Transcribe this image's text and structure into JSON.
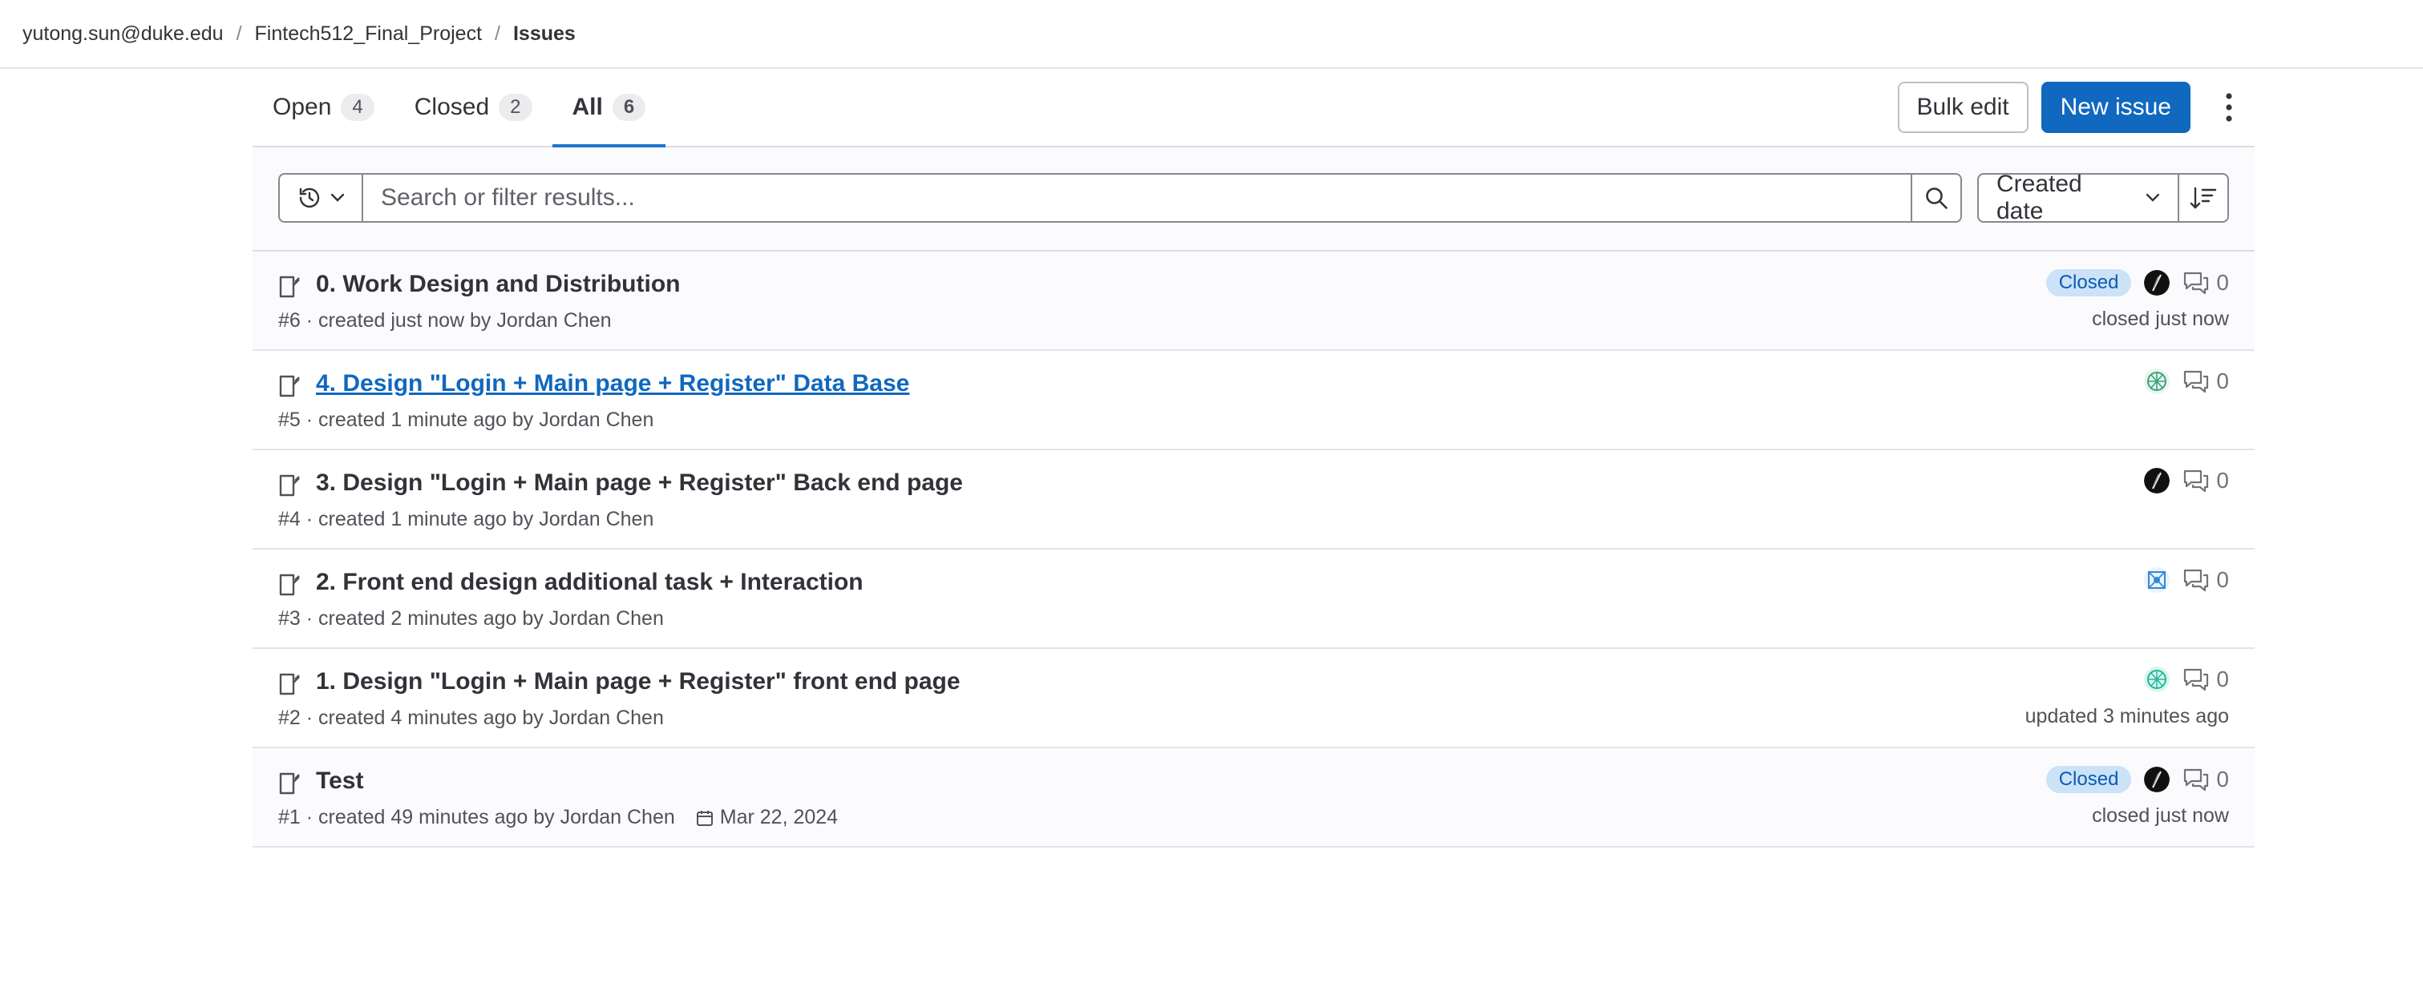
{
  "breadcrumb": {
    "user": "yutong.sun@duke.edu",
    "project": "Fintech512_Final_Project",
    "current": "Issues"
  },
  "tabs": [
    {
      "label": "Open",
      "count": "4"
    },
    {
      "label": "Closed",
      "count": "2"
    },
    {
      "label": "All",
      "count": "6"
    }
  ],
  "actions": {
    "bulk_edit": "Bulk edit",
    "new_issue": "New issue"
  },
  "filter": {
    "placeholder": "Search or filter results...",
    "sort_label": "Created date"
  },
  "issues": [
    {
      "title": "0. Work Design and Distribution",
      "meta": "#6 · created just now by Jordan Chen",
      "status": "Closed",
      "comments": "0",
      "right_note": "closed just now"
    },
    {
      "title": "4. Design \"Login + Main page + Register\" Data Base",
      "meta": "#5 · created 1 minute ago by Jordan Chen",
      "comments": "0"
    },
    {
      "title": "3. Design \"Login + Main page + Register\" Back end page",
      "meta": "#4 · created 1 minute ago by Jordan Chen",
      "comments": "0"
    },
    {
      "title": "2. Front end design additional task + Interaction",
      "meta": "#3 · created 2 minutes ago by Jordan Chen",
      "comments": "0"
    },
    {
      "title": "1. Design \"Login + Main page + Register\" front end page",
      "meta": "#2 · created 4 minutes ago by Jordan Chen",
      "comments": "0",
      "right_note": "updated 3 minutes ago"
    },
    {
      "title": "Test",
      "meta": "#1 · created 49 minutes ago by Jordan Chen",
      "due_date": "Mar 22, 2024",
      "status": "Closed",
      "comments": "0",
      "right_note": "closed just now"
    }
  ],
  "colors": {
    "accent": "#1068bf",
    "closed_badge_bg": "#cbe2f9",
    "closed_badge_text": "#0b5cad"
  },
  "icons": [
    "history-icon",
    "chevron-down-icon",
    "search-icon",
    "sort-icon",
    "kebab-icon",
    "issue-icon",
    "comment-icon",
    "calendar-icon"
  ]
}
